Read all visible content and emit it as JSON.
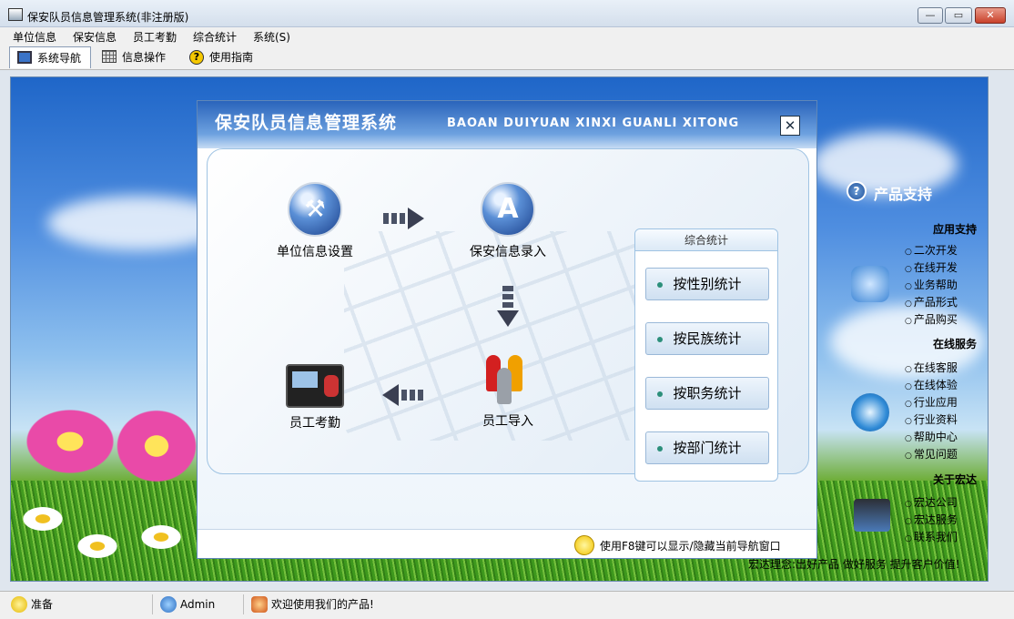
{
  "window": {
    "title": "保安队员信息管理系统(非注册版)",
    "min_label": "—",
    "max_label": "▭",
    "close_label": "✕"
  },
  "menu": [
    "单位信息",
    "保安信息",
    "员工考勤",
    "综合统计",
    "系统(S)"
  ],
  "toolbar": {
    "tabs": [
      {
        "label": "系统导航",
        "icon": "monitor-icon",
        "active": true
      },
      {
        "label": "信息操作",
        "icon": "grid-icon",
        "active": false
      },
      {
        "label": "使用指南",
        "icon": "help-icon",
        "active": false
      }
    ]
  },
  "support": {
    "title": "产品支持",
    "sections": [
      {
        "heading": "应用支持",
        "links": [
          "二次开发",
          "在线开发",
          "业务帮助",
          "产品形式",
          "产品购买"
        ]
      },
      {
        "heading": "在线服务",
        "links": [
          "在线客服",
          "在线体验",
          "行业应用",
          "行业资料",
          "帮助中心",
          "常见问题"
        ]
      },
      {
        "heading": "关于宏达",
        "links": [
          "宏达公司",
          "宏达服务",
          "联系我们"
        ]
      }
    ],
    "motto": "宏达理念:出好产品 做好服务 提升客户价值!"
  },
  "dialog": {
    "title": "保安队员信息管理系统",
    "subtitle": "BAOAN DUIYUAN XINXI GUANLI XITONG",
    "close_label": "✕",
    "nodes": {
      "unit": "单位信息设置",
      "guard": "保安信息录入",
      "import": "员工导入",
      "attendance": "员工考勤"
    },
    "stats": {
      "heading": "综合统计",
      "buttons": [
        "按性别统计",
        "按民族统计",
        "按职务统计",
        "按部门统计"
      ]
    },
    "footer": "使用F8键可以显示/隐藏当前导航窗口"
  },
  "statusbar": {
    "status": "准备",
    "user": "Admin",
    "welcome": "欢迎使用我们的产品!"
  }
}
